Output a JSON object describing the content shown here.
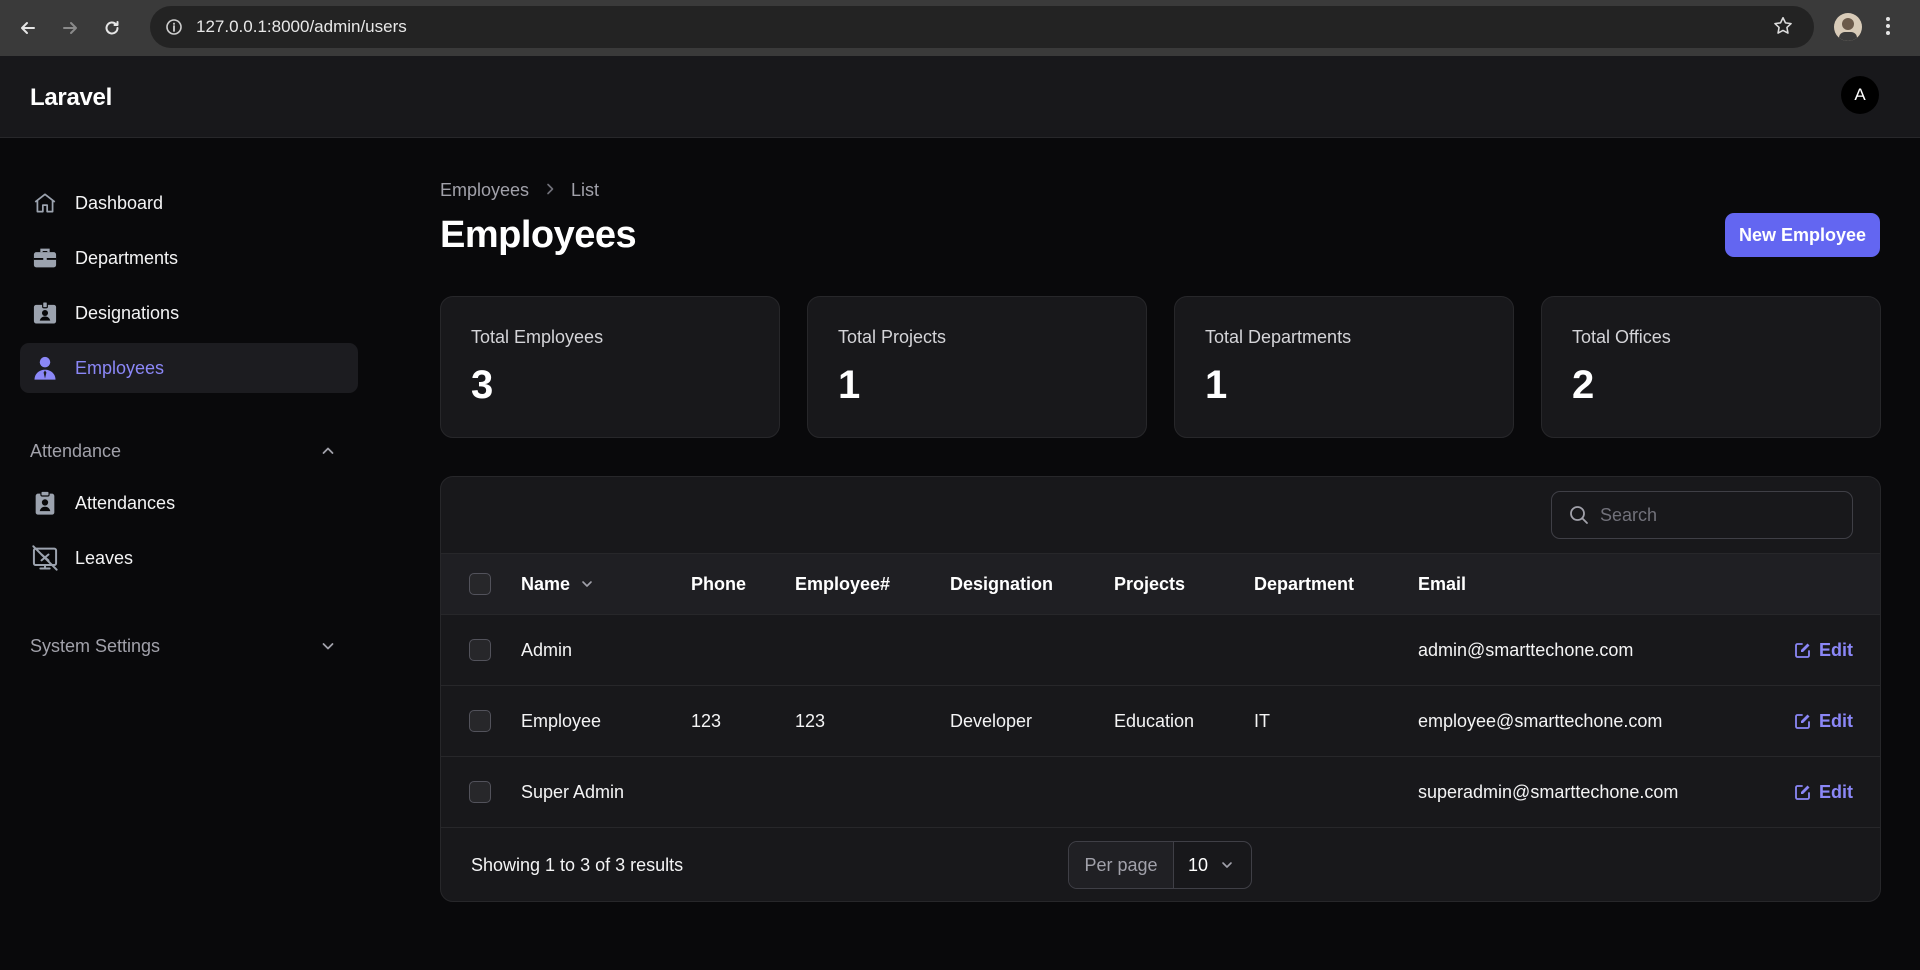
{
  "browser": {
    "url": "127.0.0.1:8000/admin/users"
  },
  "app": {
    "brand": "Laravel",
    "user_initial": "A"
  },
  "sidebar": {
    "items": [
      {
        "label": "Dashboard",
        "icon": "home-icon"
      },
      {
        "label": "Departments",
        "icon": "briefcase-icon"
      },
      {
        "label": "Designations",
        "icon": "id-badge-icon"
      },
      {
        "label": "Employees",
        "icon": "user-icon",
        "active": true
      }
    ],
    "groups": [
      {
        "label": "Attendance",
        "expanded": true,
        "items": [
          {
            "label": "Attendances",
            "icon": "clipboard-user-icon"
          },
          {
            "label": "Leaves",
            "icon": "screen-share-off-icon"
          }
        ]
      },
      {
        "label": "System Settings",
        "expanded": false
      }
    ]
  },
  "page": {
    "breadcrumb": [
      "Employees",
      "List"
    ],
    "title": "Employees",
    "new_button": "New Employee"
  },
  "stats": [
    {
      "label": "Total Employees",
      "value": "3"
    },
    {
      "label": "Total Projects",
      "value": "1"
    },
    {
      "label": "Total Departments",
      "value": "1"
    },
    {
      "label": "Total Offices",
      "value": "2"
    }
  ],
  "table": {
    "search_placeholder": "Search",
    "columns": [
      "Name",
      "Phone",
      "Employee#",
      "Designation",
      "Projects",
      "Department",
      "Email"
    ],
    "rows": [
      {
        "name": "Admin",
        "phone": "",
        "employee_no": "",
        "designation": "",
        "projects": "",
        "department": "",
        "email": "admin@smarttechone.com",
        "action": "Edit"
      },
      {
        "name": "Employee",
        "phone": "123",
        "employee_no": "123",
        "designation": "Developer",
        "projects": "Education",
        "department": "IT",
        "email": "employee@smarttechone.com",
        "action": "Edit"
      },
      {
        "name": "Super Admin",
        "phone": "",
        "employee_no": "",
        "designation": "",
        "projects": "",
        "department": "",
        "email": "superadmin@smarttechone.com",
        "action": "Edit"
      }
    ],
    "summary": "Showing 1 to 3 of 3 results",
    "per_page_label": "Per page",
    "per_page_value": "10"
  },
  "colors": {
    "accent": "#6366f1",
    "accent_text": "#8b87f7",
    "background": "#09090b",
    "card": "#18181b"
  }
}
